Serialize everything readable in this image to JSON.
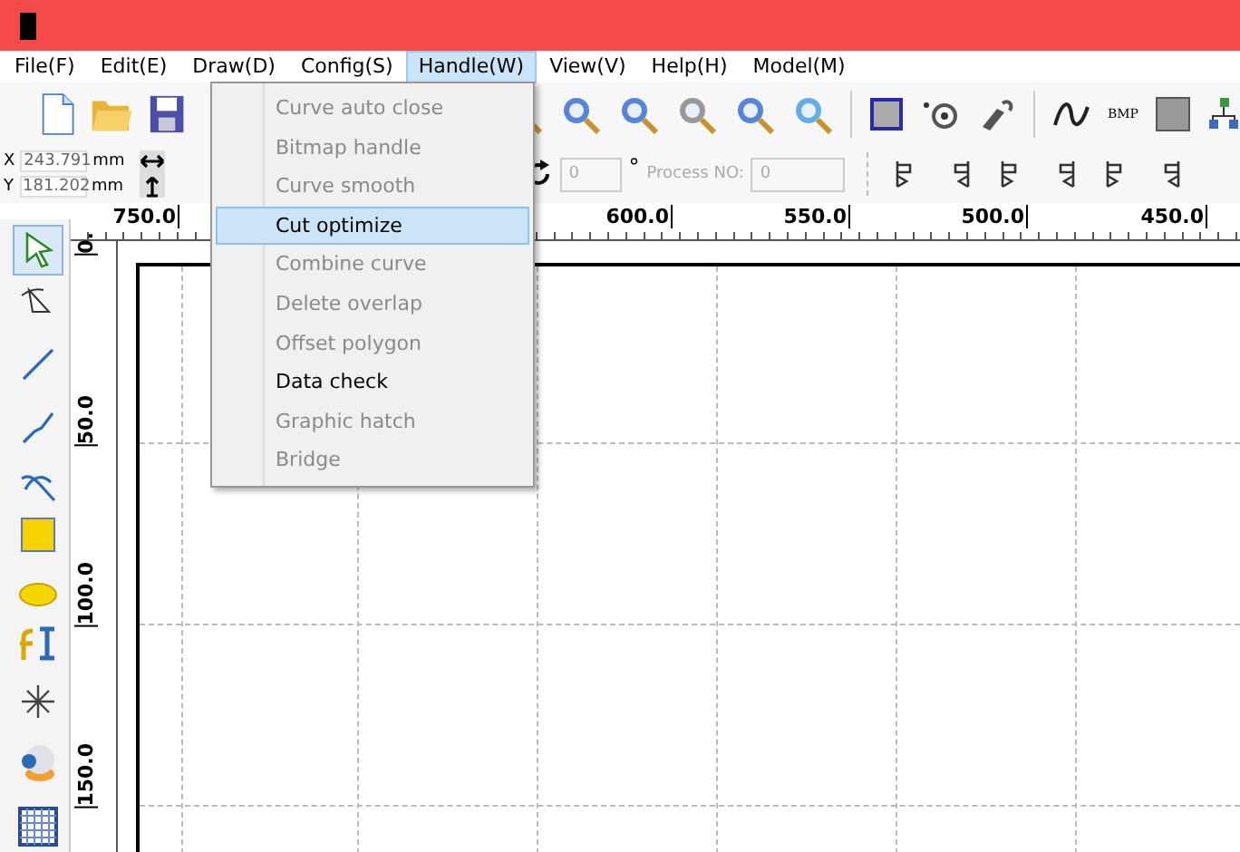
{
  "menu_bar": [
    {
      "label": "File(F)",
      "selected": false
    },
    {
      "label": "Edit(E)",
      "selected": false
    },
    {
      "label": "Draw(D)",
      "selected": false
    },
    {
      "label": "Config(S)",
      "selected": false
    },
    {
      "label": "Handle(W)",
      "selected": true
    },
    {
      "label": "View(V)",
      "selected": false
    },
    {
      "label": "Help(H)",
      "selected": false
    },
    {
      "label": "Model(M)",
      "selected": false
    }
  ],
  "dropdown": [
    {
      "label": "Curve auto close",
      "disabled": true,
      "selected": false
    },
    {
      "label": "Bitmap handle",
      "disabled": true,
      "selected": false
    },
    {
      "label": "Curve smooth",
      "disabled": true,
      "selected": false
    },
    {
      "label": "Cut optimize",
      "disabled": false,
      "selected": true
    },
    {
      "label": "Combine curve",
      "disabled": true,
      "selected": false
    },
    {
      "label": "Delete overlap",
      "disabled": true,
      "selected": false
    },
    {
      "label": "Offset polygon",
      "disabled": true,
      "selected": false
    },
    {
      "label": "Data check",
      "disabled": false,
      "selected": false
    },
    {
      "label": "Graphic hatch",
      "disabled": true,
      "selected": false
    },
    {
      "label": "Bridge",
      "disabled": true,
      "selected": false
    }
  ],
  "toolbar": {
    "bitmap_label": "BMP"
  },
  "coordinates": [
    {
      "axis": "X",
      "value": "243.791",
      "unit": "mm"
    },
    {
      "axis": "Y",
      "value": "181.202",
      "unit": "mm"
    }
  ],
  "rotation": {
    "value": "0",
    "unit": "°"
  },
  "process": {
    "label": "Process NO:",
    "value": "0"
  },
  "horizontal_ruler": [
    "750.0",
    "600.0",
    "550.0",
    "500.0",
    "450.0"
  ],
  "vertical_ruler": [
    "0.",
    "50.0",
    "100.0",
    "150.0"
  ],
  "tools": [
    {
      "kind": "select",
      "selected": true
    },
    {
      "kind": "node",
      "selected": false
    },
    {
      "kind": "line",
      "selected": false
    },
    {
      "kind": "polyline",
      "selected": false
    },
    {
      "kind": "bezier",
      "selected": false
    },
    {
      "kind": "rectangle",
      "selected": false
    },
    {
      "kind": "ellipse",
      "selected": false
    },
    {
      "kind": "text",
      "selected": false
    },
    {
      "kind": "star",
      "selected": false
    },
    {
      "kind": "camera",
      "selected": false
    },
    {
      "kind": "grid",
      "selected": false
    }
  ]
}
